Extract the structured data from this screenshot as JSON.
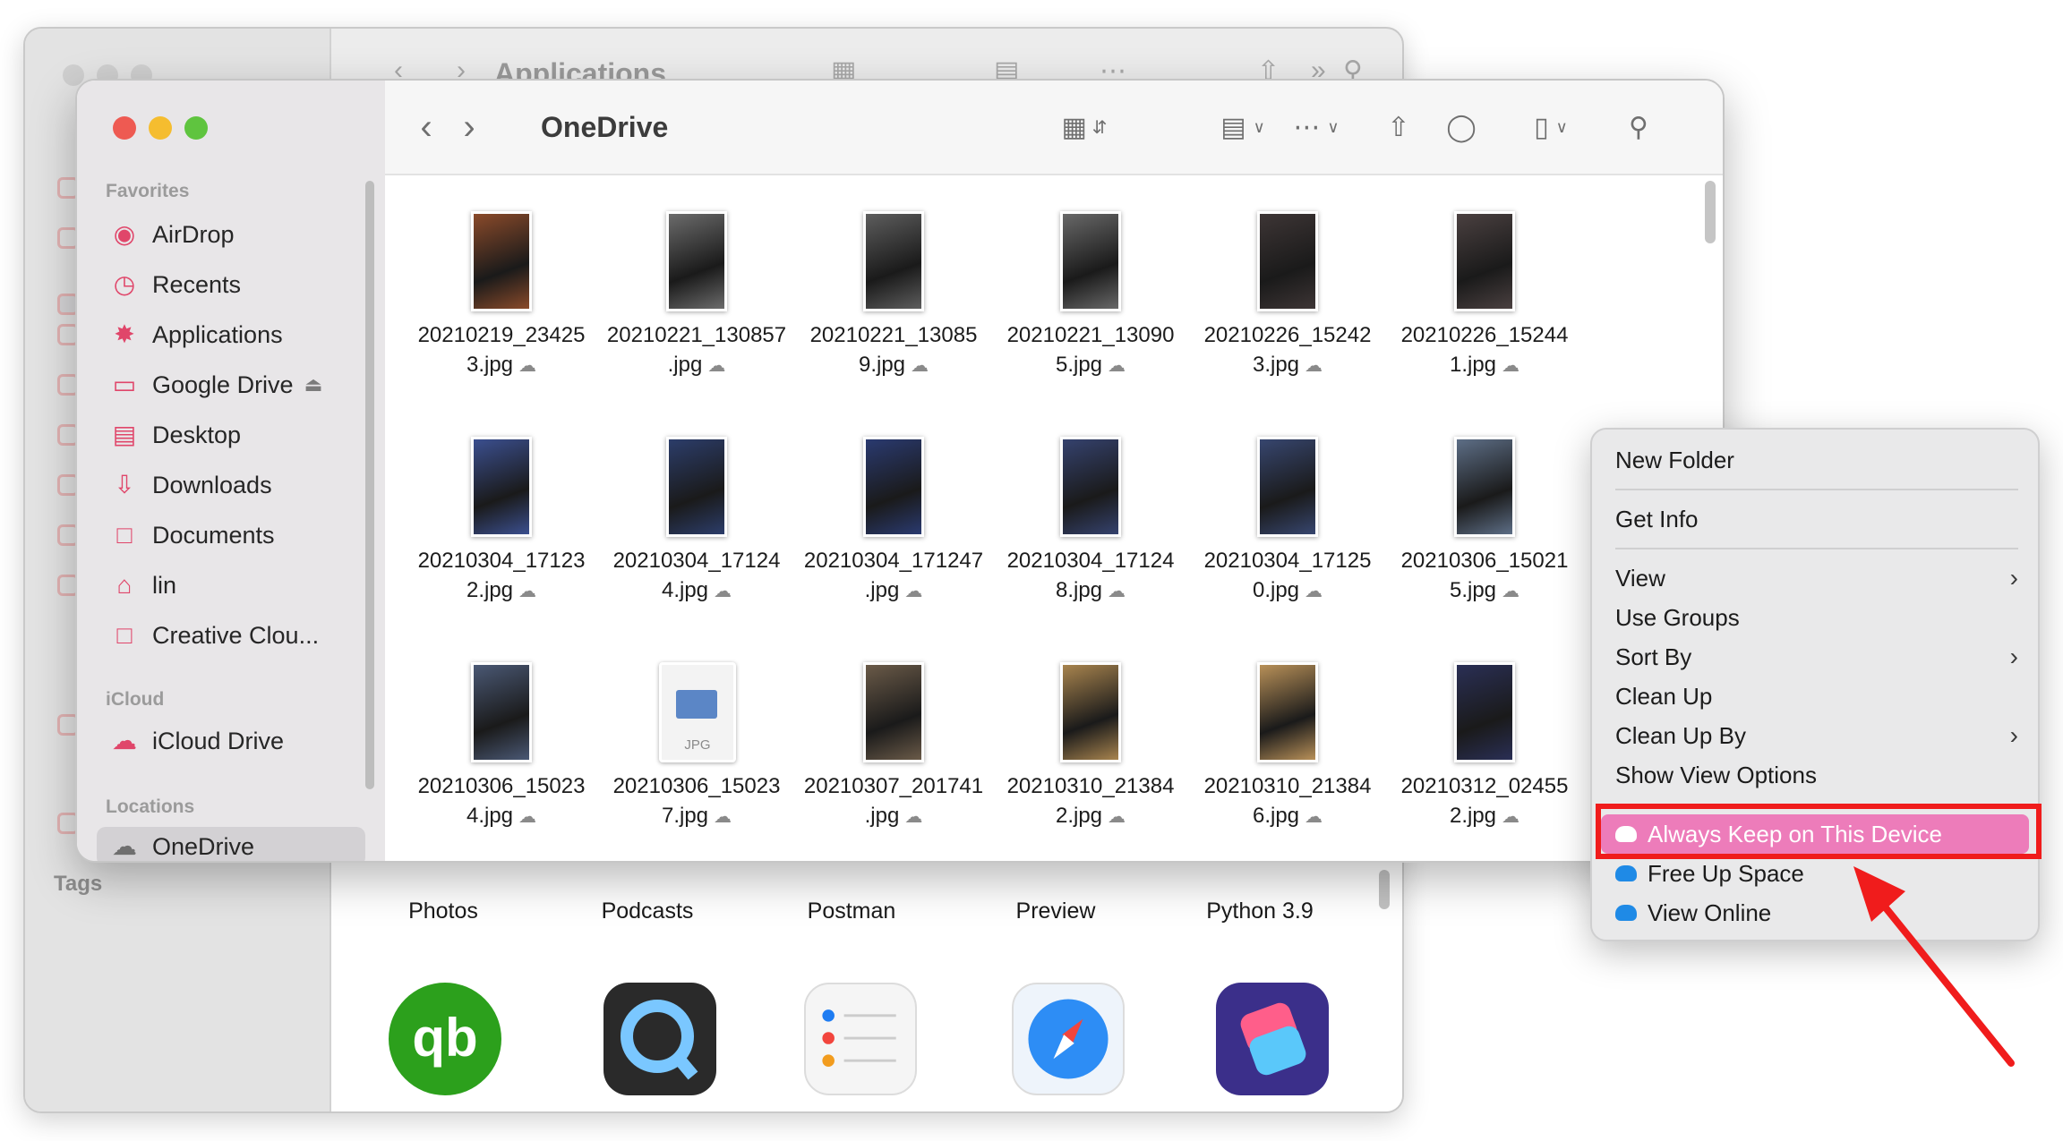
{
  "back_window": {
    "title": "Applications",
    "apps": [
      {
        "label": "Photos"
      },
      {
        "label": "Podcasts"
      },
      {
        "label": "Postman"
      },
      {
        "label": "Preview"
      },
      {
        "label": "Python 3.9"
      }
    ],
    "bottom_apps": [
      {
        "name": "quickbooks-icon",
        "color": "#2ca01c"
      },
      {
        "name": "quicktime-icon",
        "color": "#2a2a2a"
      },
      {
        "name": "reminders-icon",
        "color": "#f5f5f5"
      },
      {
        "name": "safari-icon",
        "color": "#e8f2ff"
      },
      {
        "name": "shortcuts-icon",
        "color": "#3b2f8a"
      }
    ]
  },
  "window": {
    "title": "OneDrive"
  },
  "sidebar": {
    "favorites_label": "Favorites",
    "icloud_label": "iCloud",
    "locations_label": "Locations",
    "favorites": [
      {
        "label": "AirDrop",
        "icon": "airdrop-icon"
      },
      {
        "label": "Recents",
        "icon": "clock-icon"
      },
      {
        "label": "Applications",
        "icon": "applications-icon"
      },
      {
        "label": "Google Drive",
        "icon": "folder-icon"
      },
      {
        "label": "Desktop",
        "icon": "desktop-icon"
      },
      {
        "label": "Downloads",
        "icon": "downloads-icon"
      },
      {
        "label": "Documents",
        "icon": "document-icon"
      },
      {
        "label": "lin",
        "icon": "home-icon"
      },
      {
        "label": "Creative Clou...",
        "icon": "document-icon"
      }
    ],
    "icloud": [
      {
        "label": "iCloud Drive",
        "icon": "cloud-icon"
      }
    ],
    "locations": [
      {
        "label": "OneDrive",
        "icon": "cloud-icon"
      }
    ],
    "tags_label": "Tags"
  },
  "files": [
    {
      "line1": "20210219_23425",
      "line2": "3.jpg",
      "tone": "#8a4a2a"
    },
    {
      "line1": "20210221_130857",
      "line2": ".jpg",
      "tone": "#6b6b6b"
    },
    {
      "line1": "20210221_13085",
      "line2": "9.jpg",
      "tone": "#5d5d5d"
    },
    {
      "line1": "20210221_13090",
      "line2": "5.jpg",
      "tone": "#686868"
    },
    {
      "line1": "20210226_15242",
      "line2": "3.jpg",
      "tone": "#3d3535"
    },
    {
      "line1": "20210226_15244",
      "line2": "1.jpg",
      "tone": "#4a4040"
    },
    {
      "line1": "20210304_17123",
      "line2": "2.jpg",
      "tone": "#3b4f8f"
    },
    {
      "line1": "20210304_17124",
      "line2": "4.jpg",
      "tone": "#2c3d6a"
    },
    {
      "line1": "20210304_171247",
      "line2": ".jpg",
      "tone": "#2a3a70"
    },
    {
      "line1": "20210304_17124",
      "line2": "8.jpg",
      "tone": "#35426e"
    },
    {
      "line1": "20210304_17125",
      "line2": "0.jpg",
      "tone": "#37466f"
    },
    {
      "line1": "20210306_15021",
      "line2": "5.jpg",
      "tone": "#5d6e86"
    },
    {
      "line1": "20210306_15023",
      "line2": "4.jpg",
      "tone": "#4a5874"
    },
    {
      "line1": "20210306_15023",
      "line2": "7.jpg",
      "tone": "jpg",
      "badge": "JPG"
    },
    {
      "line1": "20210307_201741",
      "line2": ".jpg",
      "tone": "#6a5a48"
    },
    {
      "line1": "20210310_21384",
      "line2": "2.jpg",
      "tone": "#a8844e"
    },
    {
      "line1": "20210310_21384",
      "line2": "6.jpg",
      "tone": "#b89058"
    },
    {
      "line1": "20210312_02455",
      "line2": "2.jpg",
      "tone": "#2a2f55"
    }
  ],
  "context_menu": {
    "new_folder": "New Folder",
    "get_info": "Get Info",
    "view": "View",
    "use_groups": "Use Groups",
    "sort_by": "Sort By",
    "clean_up": "Clean Up",
    "clean_up_by": "Clean Up By",
    "show_view_options": "Show View Options",
    "always_keep": "Always Keep on This Device",
    "free_up_space": "Free Up Space",
    "view_online": "View Online"
  },
  "colors": {
    "highlight_pink": "#ed7cba",
    "annotation_red": "#f01c1c",
    "onedrive_blue": "#1f8ae6",
    "sidebar_icon": "#e0466a"
  }
}
